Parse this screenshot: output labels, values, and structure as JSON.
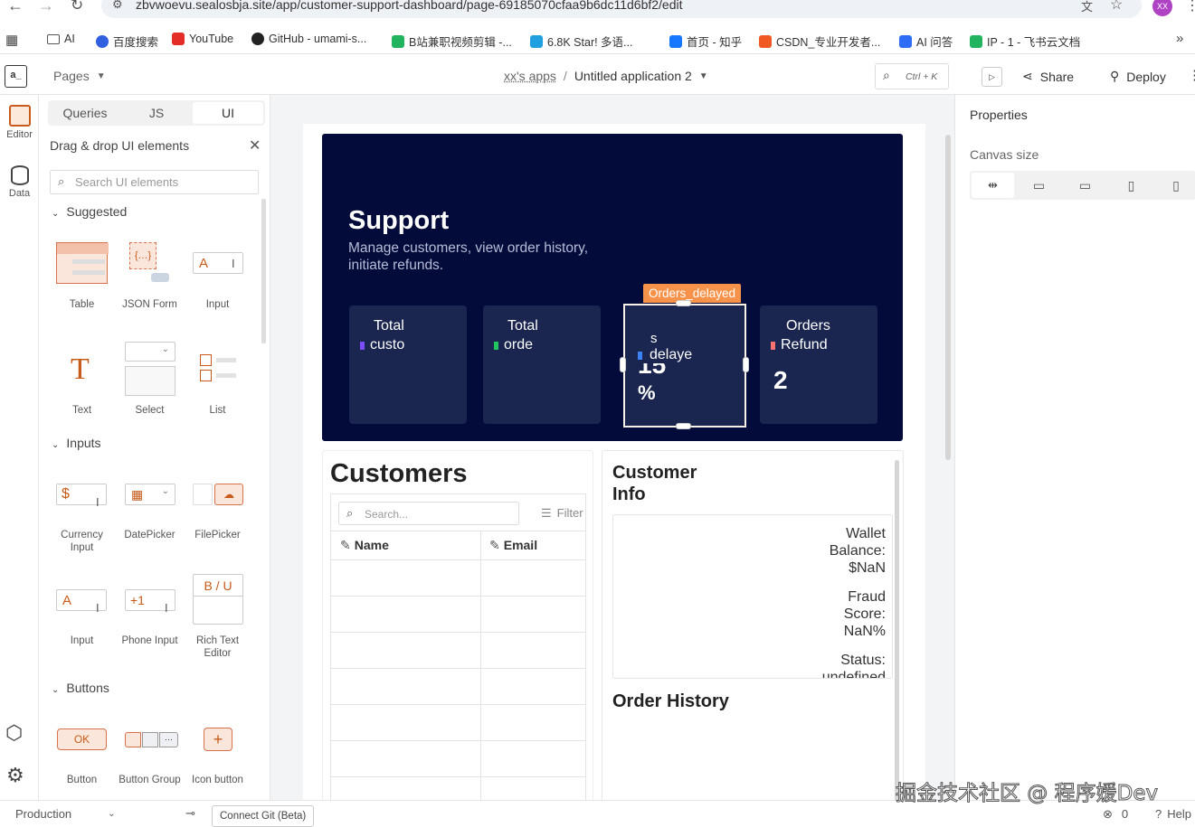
{
  "browser": {
    "url": "zbvwoevu.sealosbja.site/app/customer-support-dashboard/page-69185070cfaa9b6dc11d6bf2/edit",
    "avatar": "XX",
    "bookmarks": [
      "AI",
      "百度搜索",
      "YouTube",
      "GitHub - umami-s...",
      "B站兼职视频剪辑 -...",
      "6.8K Star! 多语...",
      "首页 - 知乎",
      "CSDN_专业开发者...",
      "AI 问答",
      "IP - 1 - 飞书云文档"
    ]
  },
  "topbar": {
    "logo": "a_",
    "pages_label": "Pages",
    "breadcrumb_app": "xx's apps",
    "breadcrumb_sep": "/",
    "app_name": "Untitled application 2",
    "search_shortcut": "Ctrl + K",
    "share_label": "Share",
    "deploy_label": "Deploy"
  },
  "leftrail": {
    "editor_label": "Editor",
    "data_label": "Data"
  },
  "widgets": {
    "tabs": [
      "Queries",
      "JS",
      "UI"
    ],
    "header": "Drag & drop UI elements",
    "search_placeholder": "Search UI elements",
    "sections": {
      "suggested": "Suggested",
      "inputs": "Inputs",
      "buttons": "Buttons"
    },
    "suggested": [
      "Table",
      "JSON Form",
      "Input",
      "Text",
      "Select",
      "List"
    ],
    "inputs": [
      "Currency Input",
      "DatePicker",
      "FilePicker",
      "Input",
      "Phone Input",
      "Rich Text Editor"
    ],
    "buttons": [
      "Button",
      "Button Group",
      "Icon button"
    ],
    "button_ok": "OK",
    "currency_symbol": "$",
    "phone_prefix": "+1",
    "rte_glyphs": "B / U",
    "input_glyph": "A",
    "text_glyph": "T"
  },
  "canvas": {
    "hero_title": "Support",
    "hero_subtitle": "Manage customers, view order history, initiate refunds.",
    "selected_badge": "Orders_delayed",
    "stats": [
      {
        "top": "Total",
        "label": "custo",
        "color": "#7c4dff"
      },
      {
        "top": "Total",
        "label": "orde",
        "color": "#22c55e"
      },
      {
        "top": "s",
        "label": "delaye",
        "value": "15",
        "value2": "%",
        "color": "#3b82f6"
      },
      {
        "top": "Orders",
        "label": "Refund",
        "value": "2",
        "color": "#f87171"
      }
    ],
    "customers_title": "Customers",
    "table_search_placeholder": "Search...",
    "filter_label": "Filter",
    "columns": [
      "Name",
      "Email"
    ],
    "info_title": "Customer Info",
    "wallet_label": "Wallet Balance:",
    "wallet_value": "$NaN",
    "fraud_label": "Fraud Score:",
    "fraud_value": "NaN%",
    "status_label": "Status:",
    "status_value": "undefined",
    "order_history_title": "Order History"
  },
  "properties": {
    "title": "Properties",
    "canvas_size_label": "Canvas size"
  },
  "footer": {
    "env": "Production",
    "git": "Connect Git (Beta)",
    "errors": "0",
    "help": "Help"
  },
  "watermark": "掘金技术社区 @ 程序媛Dev"
}
